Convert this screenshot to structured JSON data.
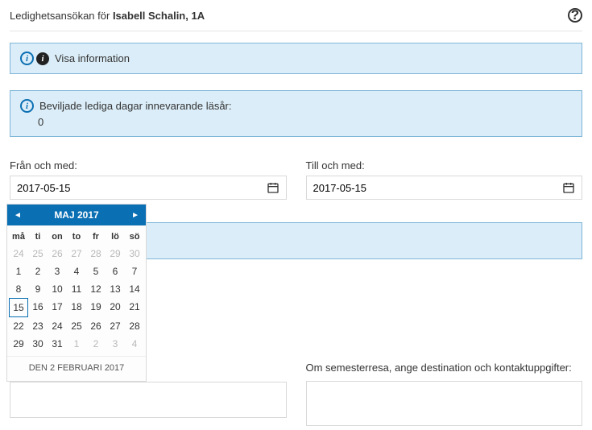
{
  "header": {
    "title_prefix": "Ledighetsansökan för ",
    "student_name": "Isabell Schalin",
    "class_suffix": ", 1A"
  },
  "info_box1": {
    "text": "Visa information"
  },
  "info_box2": {
    "text": "Beviljade lediga dagar innevarande läsår:",
    "count": "0"
  },
  "from": {
    "label": "Från och med:",
    "value": "2017-05-15"
  },
  "to": {
    "label": "Till och med:",
    "value": "2017-05-15"
  },
  "datepicker": {
    "month_label": "MAJ 2017",
    "dow": [
      "må",
      "ti",
      "on",
      "to",
      "fr",
      "lö",
      "sö"
    ],
    "footer": "DEN 2 FEBRUARI 2017",
    "days": [
      {
        "n": "24",
        "other": true
      },
      {
        "n": "25",
        "other": true
      },
      {
        "n": "26",
        "other": true
      },
      {
        "n": "27",
        "other": true
      },
      {
        "n": "28",
        "other": true
      },
      {
        "n": "29",
        "other": true
      },
      {
        "n": "30",
        "other": true
      },
      {
        "n": "1"
      },
      {
        "n": "2"
      },
      {
        "n": "3"
      },
      {
        "n": "4"
      },
      {
        "n": "5"
      },
      {
        "n": "6"
      },
      {
        "n": "7"
      },
      {
        "n": "8"
      },
      {
        "n": "9"
      },
      {
        "n": "10"
      },
      {
        "n": "11"
      },
      {
        "n": "12"
      },
      {
        "n": "13"
      },
      {
        "n": "14"
      },
      {
        "n": "15",
        "selected": true
      },
      {
        "n": "16"
      },
      {
        "n": "17"
      },
      {
        "n": "18"
      },
      {
        "n": "19"
      },
      {
        "n": "20"
      },
      {
        "n": "21"
      },
      {
        "n": "22"
      },
      {
        "n": "23"
      },
      {
        "n": "24"
      },
      {
        "n": "25"
      },
      {
        "n": "26"
      },
      {
        "n": "27"
      },
      {
        "n": "28"
      },
      {
        "n": "29"
      },
      {
        "n": "30"
      },
      {
        "n": "31"
      },
      {
        "n": "1",
        "other": true
      },
      {
        "n": "2",
        "other": true
      },
      {
        "n": "3",
        "other": true
      },
      {
        "n": "4",
        "other": true
      }
    ]
  },
  "notes": {
    "right_label": "Om semesterresa, ange destination och kontaktuppgifter:"
  }
}
